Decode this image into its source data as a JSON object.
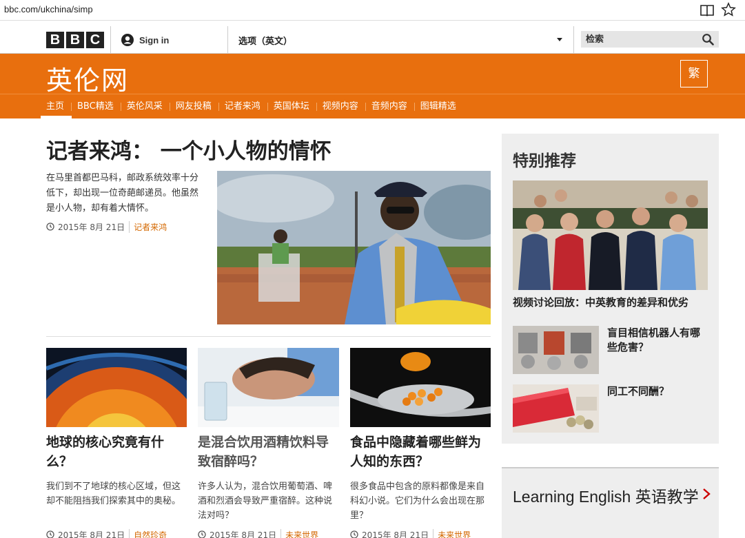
{
  "browser": {
    "url": "bbc.com/ukchina/simp",
    "icons": [
      "reader-icon",
      "star-icon"
    ]
  },
  "topbar": {
    "logo_letters": [
      "B",
      "B",
      "C"
    ],
    "signin_label": "Sign in",
    "options_label": "选项（英文）",
    "search_placeholder": "检索"
  },
  "brand": {
    "title": "英伦网",
    "traditional_label": "繁",
    "color": "#e86f0e"
  },
  "nav": {
    "items": [
      "主页",
      "BBC精选",
      "英伦风采",
      "网友投稿",
      "记者来鸿",
      "英国体坛",
      "视频内容",
      "音频内容",
      "图辑精选"
    ],
    "active_index": 0
  },
  "lead": {
    "title": "记者来鸿： 一个小人物的情怀",
    "summary": "在马里首都巴马科，邮政系统效率十分低下，却出现一位奇葩邮递员。他虽然是小人物，却有着大情怀。",
    "date": "2015年 8月 21日",
    "tag": "记者来鸿"
  },
  "stories": [
    {
      "title": "地球的核心究竟有什么？",
      "summary": "我们到不了地球的核心区域，但这却不能阻挡我们探索其中的奥秘。",
      "date": "2015年 8月 21日",
      "tag": "自然珍奇"
    },
    {
      "title": "是混合饮用酒精饮料导致宿醉吗？",
      "summary": "许多人认为，混合饮用葡萄酒、啤酒和烈酒会导致严重宿醉。这种说法对吗？",
      "date": "2015年 8月 21日",
      "tag": "未来世界"
    },
    {
      "title": "食品中隐藏着哪些鲜为人知的东西？",
      "summary": "很多食品中包含的原料都像是来自科幻小说。它们为什么会出现在那里？",
      "date": "2015年 8月 21日",
      "tag": "未来世界"
    }
  ],
  "sidebar": {
    "title": "特别推荐",
    "feature_caption": "视频讨论回放：中英教育的差异和优劣",
    "items": [
      {
        "title": "盲目相信机器人有哪些危害？"
      },
      {
        "title": "同工不同酬？"
      }
    ]
  },
  "learning": {
    "title": "Learning English 英语教学"
  }
}
